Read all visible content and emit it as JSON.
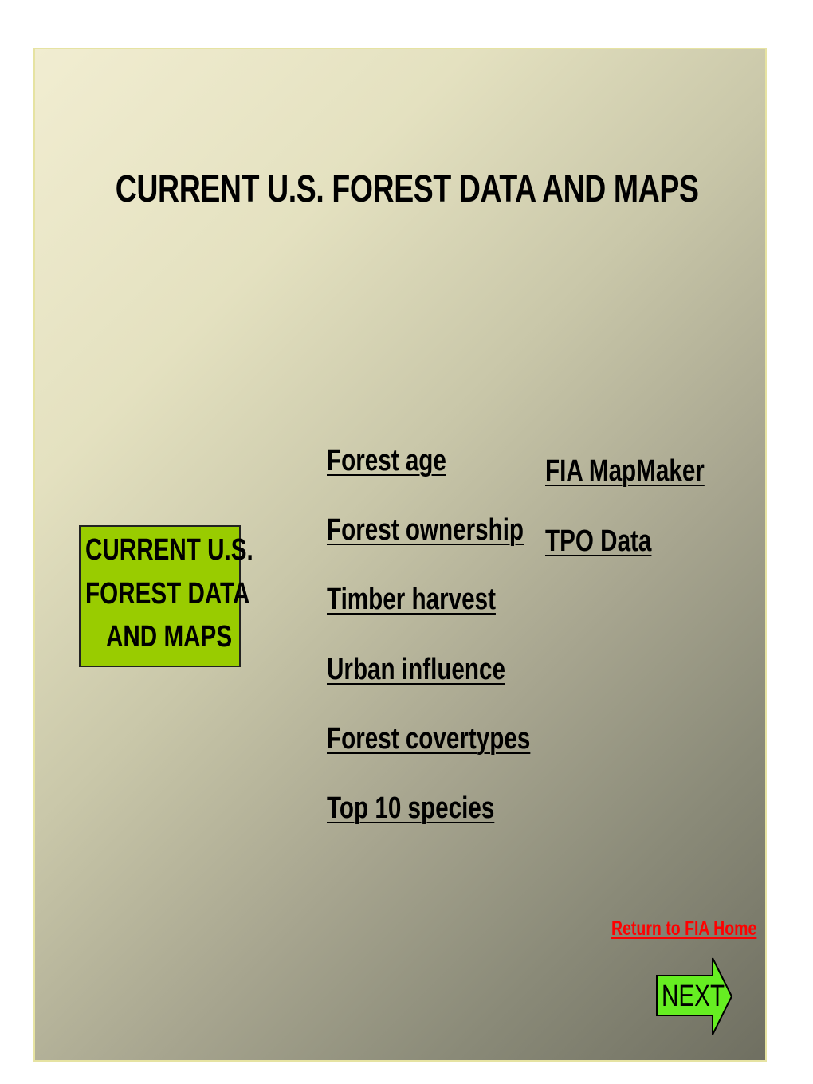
{
  "slide": {
    "title": "CURRENT U.S. FOREST DATA AND MAPS",
    "section_box": {
      "lines": [
        "CURRENT U.S.",
        "FOREST DATA",
        "AND MAPS"
      ],
      "color": "#99cc00"
    },
    "links_left": [
      {
        "label": "Forest age"
      },
      {
        "label": "Forest ownership"
      },
      {
        "label": "Timber harvest"
      },
      {
        "label": "Urban influence"
      },
      {
        "label": "Forest covertypes"
      },
      {
        "label": "Top 10 species"
      }
    ],
    "links_right": [
      {
        "label": "FIA MapMaker"
      },
      {
        "label": "TPO Data"
      }
    ],
    "home_link": {
      "label": "Return to FIA Home",
      "color": "#ff0000"
    },
    "next_button": {
      "label": "NEXT",
      "icon": "right-arrow-icon",
      "color": "#66ee22"
    }
  }
}
